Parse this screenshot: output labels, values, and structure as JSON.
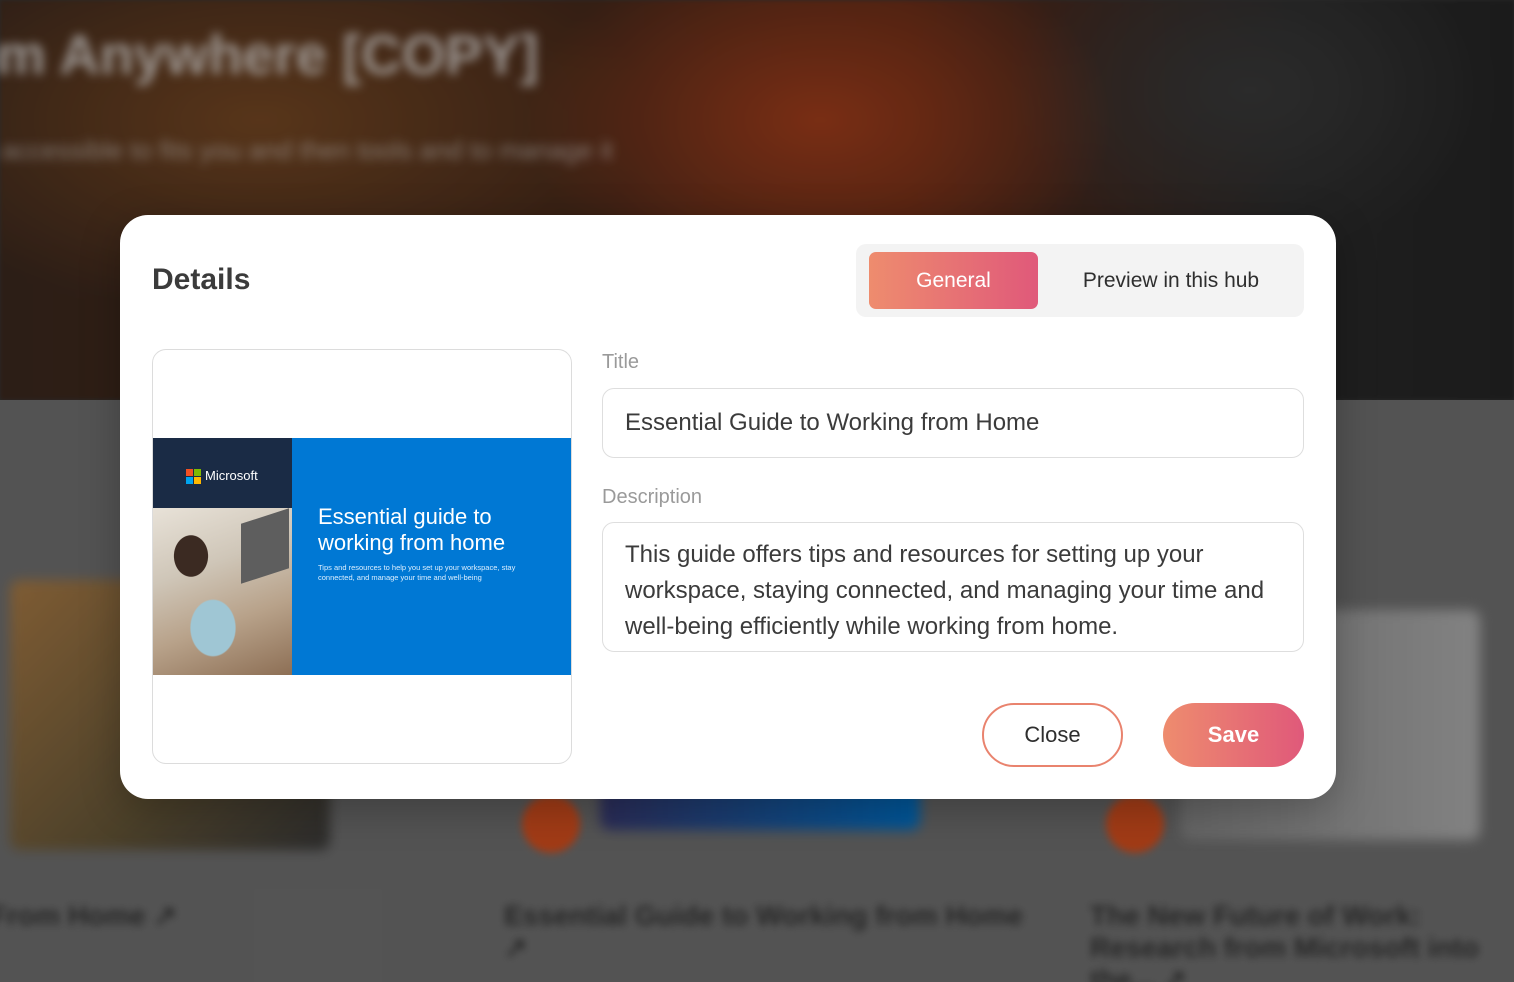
{
  "background": {
    "hero_title": "rom Anywhere [COPY]",
    "hero_subtitle": "n accessible to fits you and then tools and to manage it",
    "cards": [
      {
        "title": "From Home ↗"
      },
      {
        "title": "Essential Guide to Working from Home ↗"
      },
      {
        "title": "The New Future of Work: Research from Microsoft into the... ↗"
      }
    ]
  },
  "modal": {
    "title": "Details",
    "tabs": [
      {
        "label": "General",
        "active": true
      },
      {
        "label": "Preview in this hub",
        "active": false
      }
    ],
    "thumbnail": {
      "brand": "Microsoft",
      "heading": "Essential guide to working from home",
      "subheading": "Tips and resources to help you set up your workspace, stay connected, and manage your time and well-being"
    },
    "fields": {
      "title_label": "Title",
      "title_value": "Essential Guide to Working from Home",
      "description_label": "Description",
      "description_value": "This guide offers tips and resources for setting up your workspace, staying connected, and managing your time and well-being efficiently while working from home."
    },
    "buttons": {
      "close_label": "Close",
      "save_label": "Save"
    }
  },
  "colors": {
    "accent_start": "#ee8c6e",
    "accent_end": "#e0597a",
    "cover_blue": "#0078d4"
  }
}
